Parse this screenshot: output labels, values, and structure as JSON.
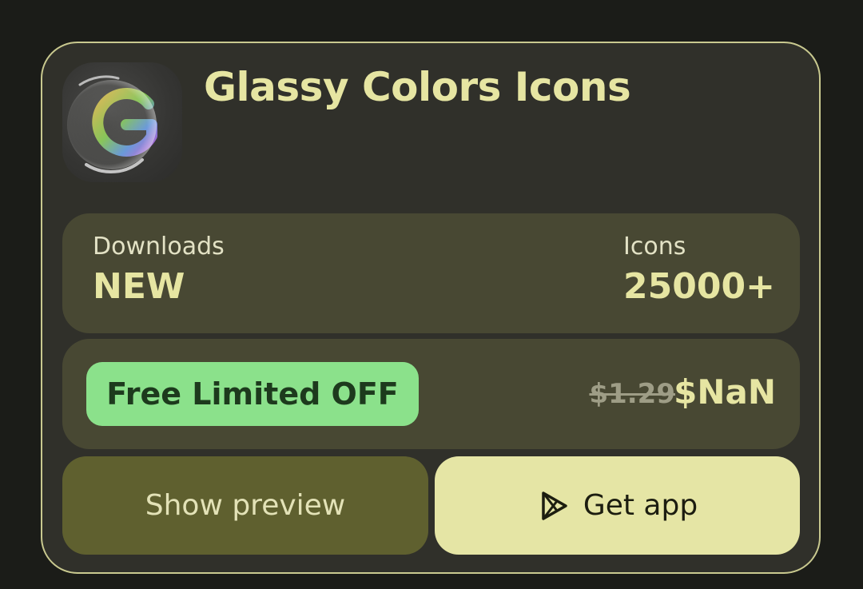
{
  "app": {
    "title": "Glassy Colors Icons",
    "icon": "glassy-g-app-icon"
  },
  "stats": {
    "downloads_label": "Downloads",
    "downloads_value": "NEW",
    "icons_label": "Icons",
    "icons_value": "25000+"
  },
  "pricing": {
    "promo_badge": "Free Limited OFF",
    "old_price": "$1.29",
    "new_price": "$NaN"
  },
  "actions": {
    "preview_label": "Show preview",
    "get_label": "Get app",
    "get_icon": "play-store-icon"
  },
  "colors": {
    "accent": "#e6e5a2",
    "badge_bg": "#8be18b",
    "preview_button_bg": "#5f602f",
    "get_button_bg": "#e5e5a5",
    "card_border": "#c9c98f"
  }
}
